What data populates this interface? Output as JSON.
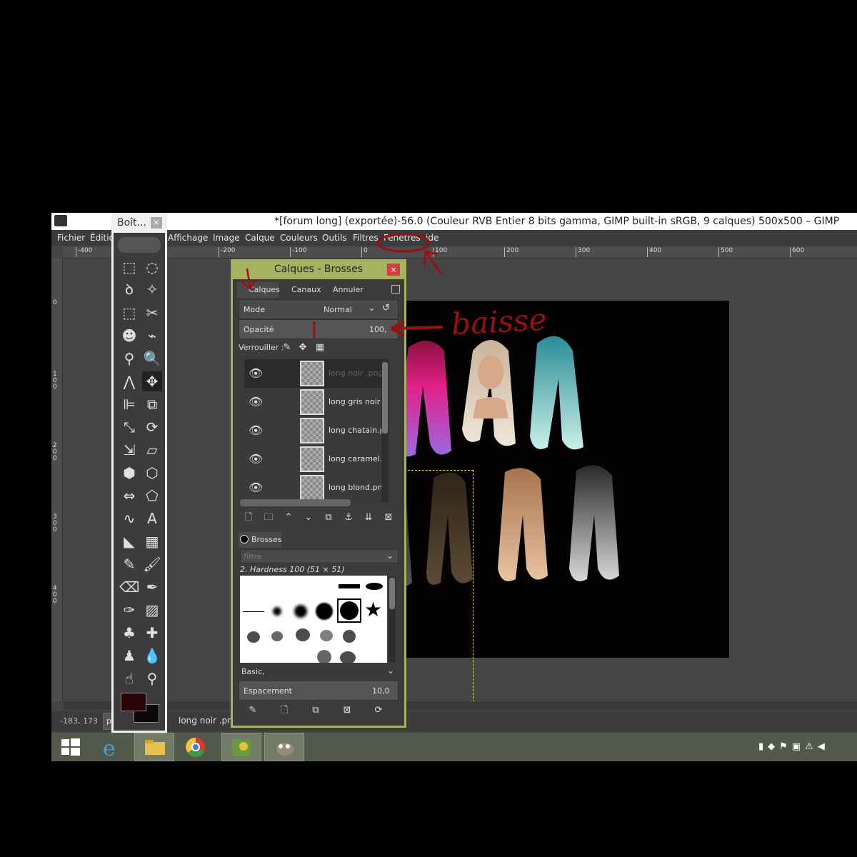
{
  "window": {
    "title": "*[forum long] (exportée)-56.0 (Couleur RVB Entier 8 bits gamma, GIMP built-in sRGB, 9 calques) 500x500 – GIMP"
  },
  "menu": [
    "Fichier",
    "Éditio",
    "Affichage",
    "Image",
    "Calque",
    "Couleurs",
    "Outils",
    "Filtres",
    "Fenêtres",
    "ide"
  ],
  "ruler": {
    "h_ticks": [
      "-400",
      "-200",
      "-100",
      "0",
      "100",
      "200",
      "300",
      "400",
      "500",
      "600"
    ],
    "v_ticks": [
      "0",
      "100",
      "200",
      "300",
      "400"
    ]
  },
  "toolbox": {
    "title": "Boît...",
    "close": "×"
  },
  "dock": {
    "title": "Calques - Brosses",
    "close": "×",
    "tabs": [
      "Calques",
      "Canaux",
      "Annuler"
    ],
    "mode_label": "Mode",
    "mode_value": "Normal",
    "opacity_label": "Opacité",
    "opacity_value": "100,",
    "lock_label": "Verrouiller :",
    "layers": [
      {
        "name": "long noir .png",
        "selected": true
      },
      {
        "name": "long gris noir .png",
        "selected": false
      },
      {
        "name": "long chatain.png",
        "selected": false
      },
      {
        "name": "long caramel.png",
        "selected": false
      },
      {
        "name": "long blond.png",
        "selected": false
      }
    ],
    "brushes_tab": "Brosses",
    "filter_placeholder": "filtre",
    "brush_name": "2. Hardness 100 (51 × 51)",
    "brush_set": "Basic,",
    "spacing_label": "Espacement",
    "spacing_value": "10,0"
  },
  "status": {
    "coords": "-183, 173",
    "unit": "p",
    "layer_name": "long noir .png"
  },
  "annotation": {
    "text": "baisse"
  },
  "colors": {
    "dock_border": "#a6b25f",
    "annotation": "#9a0f12",
    "foreground": "#2a0508",
    "taskbar": "#535a4c"
  }
}
